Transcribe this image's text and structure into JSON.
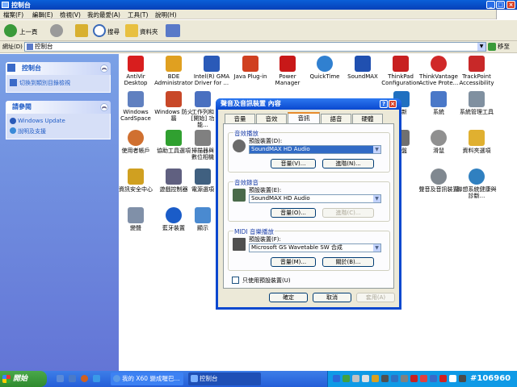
{
  "window": {
    "title": "控制台"
  },
  "menu": [
    "檔案(F)",
    "編輯(E)",
    "檢視(V)",
    "我的最愛(A)",
    "工具(T)",
    "說明(H)"
  ],
  "toolbar": {
    "back": "上一頁",
    "search": "搜尋",
    "folders": "資料夾"
  },
  "address": {
    "label": "網址(D)",
    "value": "控制台",
    "go": "移至"
  },
  "leftpane": {
    "control_panel": {
      "title": "控制台",
      "link": "切換到類別目錄檢視"
    },
    "see_also": {
      "title": "請參閱",
      "links": [
        "Windows Update",
        "說明及支援"
      ]
    }
  },
  "icons": [
    {
      "label": "AntiVir Desktop",
      "color": "#d81e1e"
    },
    {
      "label": "BDE Administrator",
      "color": "#e0a020"
    },
    {
      "label": "Intel(R) GMA Driver for ...",
      "color": "#2a5ab8"
    },
    {
      "label": "Java Plug-in",
      "color": "#d04020"
    },
    {
      "label": "Power Manager",
      "color": "#c81818"
    },
    {
      "label": "QuickTime",
      "color": "#3080d0"
    },
    {
      "label": "SoundMAX",
      "color": "#2050b0"
    },
    {
      "label": "ThinkPad Configuration",
      "color": "#c82020"
    },
    {
      "label": "ThinkVantage Active Prote...",
      "color": "#d02828"
    },
    {
      "label": "TrackPoint Accessibility",
      "color": "#c82828"
    },
    {
      "label": "Windows CardSpace",
      "color": "#6080c0"
    },
    {
      "label": "Windows 防火牆",
      "color": "#c84828"
    },
    {
      "label": "工作列和 [開始] 功能...",
      "color": "#4a70c0"
    },
    {
      "label": "更新",
      "color": "#2070c0"
    },
    {
      "label": "系統",
      "color": "#4a78c8"
    },
    {
      "label": "系統管理工具",
      "color": "#8090a0"
    },
    {
      "label": "使用者帳戶",
      "color": "#d07030"
    },
    {
      "label": "協助工具選項",
      "color": "#30a030"
    },
    {
      "label": "掃描器與數位相機",
      "color": "#808080"
    },
    {
      "label": "鍵盤",
      "color": "#707070"
    },
    {
      "label": "滑鼠",
      "color": "#909090"
    },
    {
      "label": "資料夾選項",
      "color": "#e0b030"
    },
    {
      "label": "資訊安全中心",
      "color": "#d0a020"
    },
    {
      "label": "遊戲控制器",
      "color": "#606080"
    },
    {
      "label": "電源選項",
      "color": "#406080"
    },
    {
      "label": "聲音及音訊裝置",
      "color": "#808890"
    },
    {
      "label": "聯想系統健康與診斷...",
      "color": "#3080c0"
    },
    {
      "label": "藍牙裝置",
      "color": "#1a5cc8"
    },
    {
      "label": "顯示",
      "color": "#4a8ad0"
    },
    {
      "label": "變聲",
      "color": "#8090a8"
    }
  ],
  "dialog": {
    "title": "聲音及音訊裝置 內容",
    "tabs": [
      "音量",
      "音效",
      "音訊",
      "語音",
      "硬體"
    ],
    "selected_tab": "音訊",
    "playback": {
      "title": "音效播放",
      "device_label": "預設裝置(D):",
      "device": "SoundMAX HD Audio",
      "volume_btn": "音量(V)...",
      "advanced_btn": "進階(N)..."
    },
    "recording": {
      "title": "音效錄音",
      "device_label": "預設裝置(E):",
      "device": "SoundMAX HD Audio",
      "volume_btn": "音量(O)...",
      "advanced_btn": "進階(C)..."
    },
    "midi": {
      "title": "MIDI 音樂播放",
      "device_label": "預設裝置(F):",
      "device": "Microsoft GS Wavetable SW 合成",
      "volume_btn": "音量(M)...",
      "about_btn": "關於(B)..."
    },
    "checkbox": "只使用預設裝置(U)",
    "ok": "確定",
    "cancel": "取消",
    "apply": "套用(A)"
  },
  "taskbar": {
    "start": "開始",
    "tasks": [
      "我的 X60 變成喔巴...",
      "控制台"
    ],
    "watermark": "#106960"
  }
}
